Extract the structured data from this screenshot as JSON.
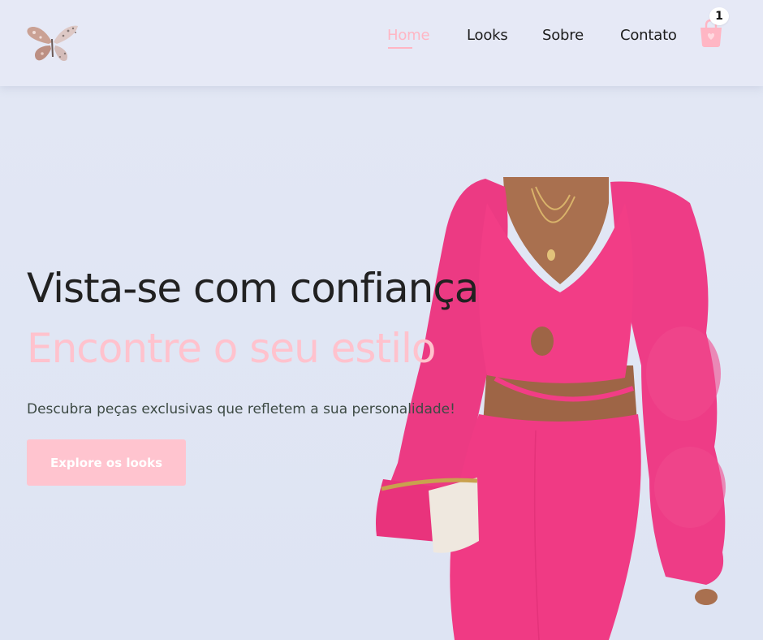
{
  "header": {
    "logo_icon": "butterfly-logo-icon",
    "nav": [
      {
        "label": "Home",
        "active": true
      },
      {
        "label": "Looks",
        "active": false
      },
      {
        "label": "Sobre",
        "active": false
      },
      {
        "label": "Contato",
        "active": false
      }
    ],
    "cart_icon": "shopping-bag-icon",
    "cart_count": "1"
  },
  "hero": {
    "title": "Vista-se com confiança",
    "subtitle": "Encontre o seu estilo",
    "description": "Descubra peças exclusivas que refletem a sua personalidade!",
    "cta_label": "Explore os looks",
    "image": "model-pink-outfit-photo"
  },
  "colors": {
    "accent_pink": "#ffb6c4",
    "button_pink": "#ffc4cf",
    "header_bg": "#e6e9f6",
    "page_bg": "#e2e7f4",
    "text_dark": "#212121",
    "outfit_pink": "#f0307a"
  }
}
